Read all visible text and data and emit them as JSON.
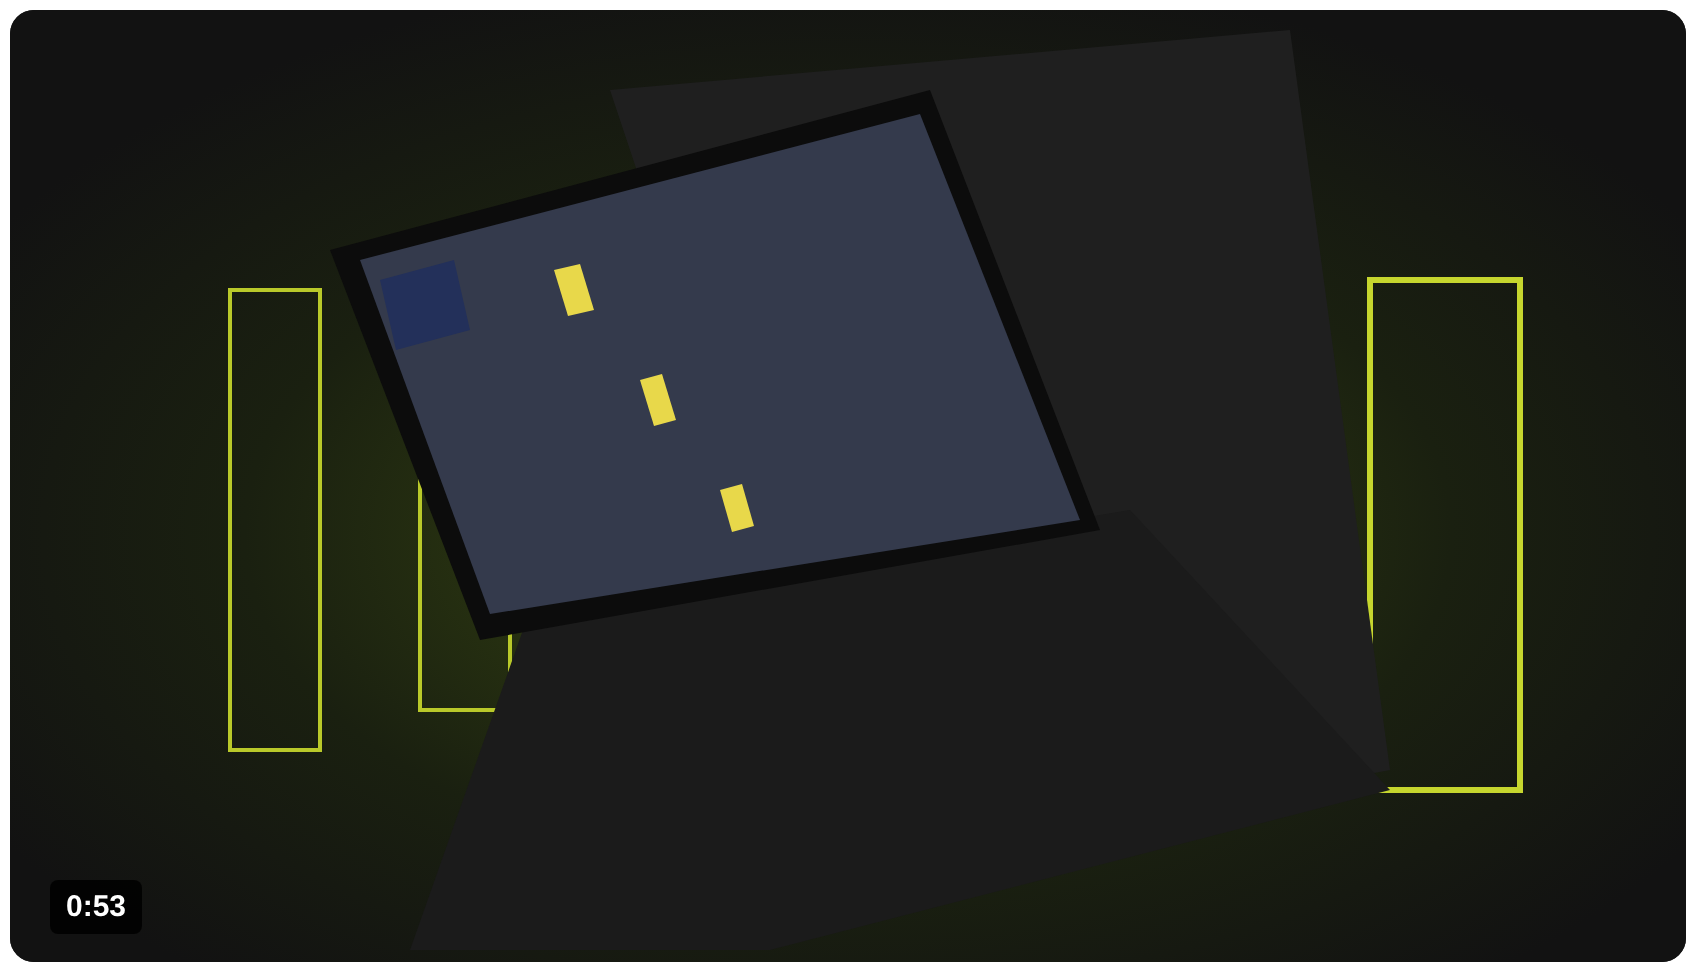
{
  "video": {
    "kind": "picture",
    "duration": "0:53"
  }
}
